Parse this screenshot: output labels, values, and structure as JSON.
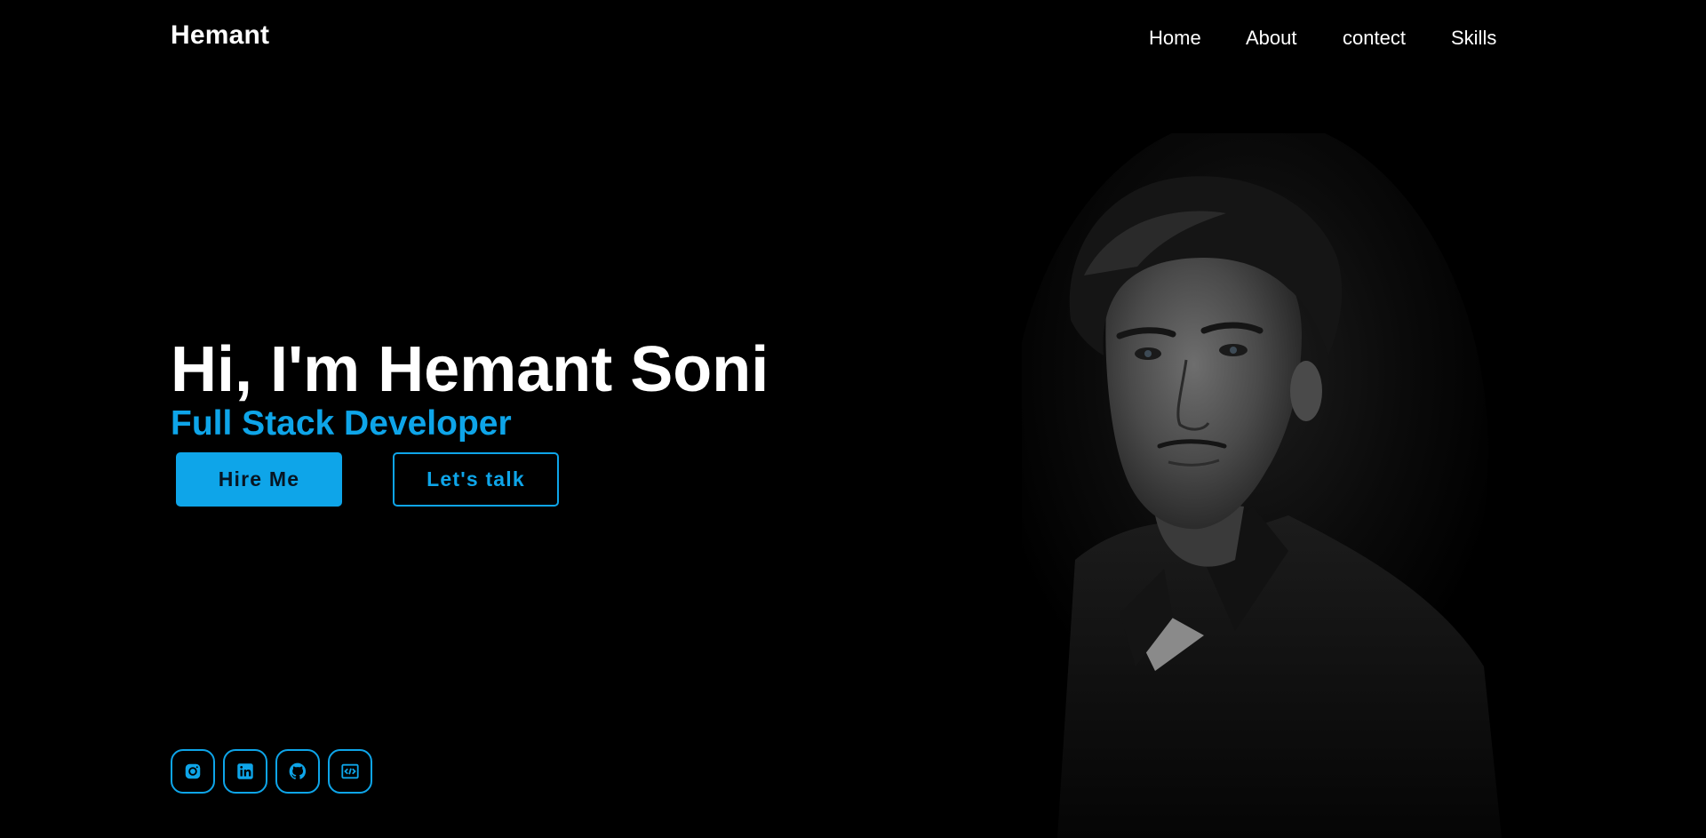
{
  "brand": {
    "name": "Hemant"
  },
  "nav": {
    "items": [
      {
        "label": "Home"
      },
      {
        "label": "About"
      },
      {
        "label": "contect"
      },
      {
        "label": "Skills"
      }
    ]
  },
  "hero": {
    "headline": "Hi, I'm Hemant Soni",
    "subtitle": "Full Stack Developer",
    "primary_button": "Hire Me",
    "secondary_button": "Let's talk"
  },
  "socials": [
    {
      "icon": "instagram-icon"
    },
    {
      "icon": "linkedin-icon"
    },
    {
      "icon": "github-icon"
    },
    {
      "icon": "code-icon"
    }
  ],
  "colors": {
    "background": "#000000",
    "accent": "#0ea5e9",
    "text": "#ffffff"
  }
}
